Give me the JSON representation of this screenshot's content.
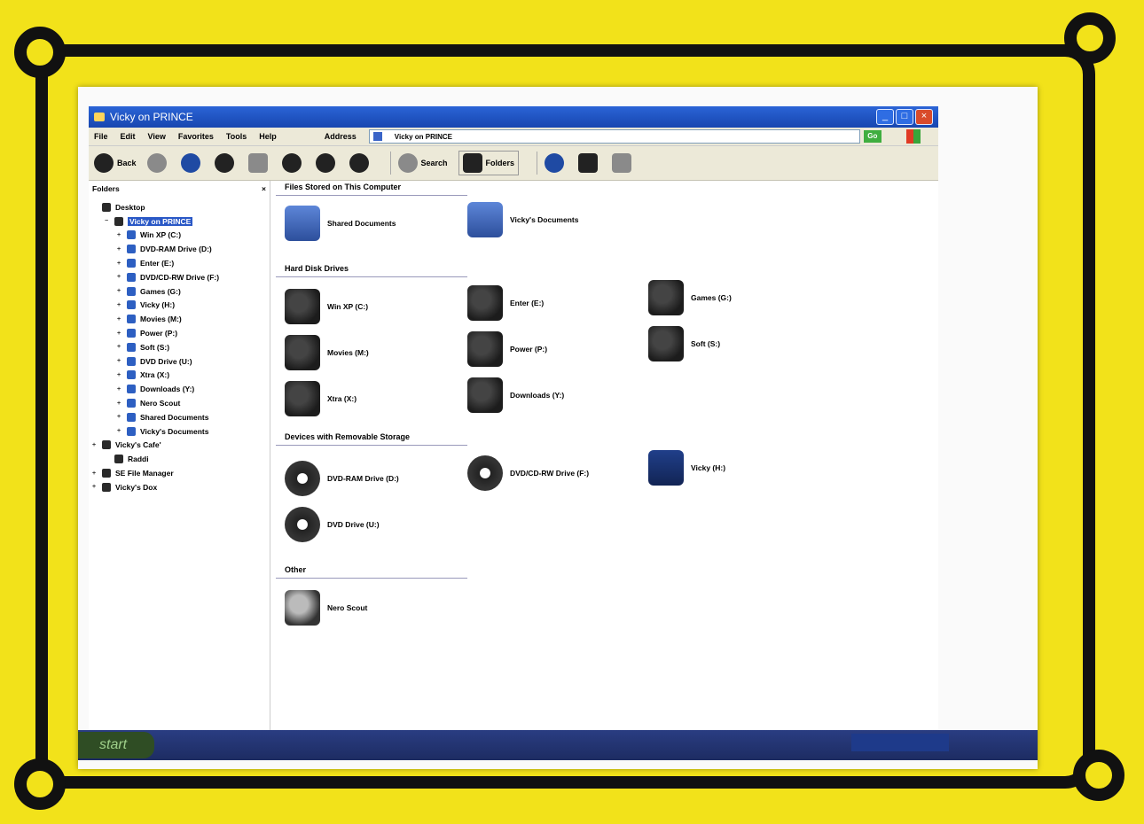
{
  "window": {
    "title": "Vicky on PRINCE",
    "controls": {
      "minimize": "_",
      "maximize": "□",
      "close": "×"
    }
  },
  "menu": {
    "items": [
      "File",
      "Edit",
      "View",
      "Favorites",
      "Tools",
      "Help"
    ],
    "address_label": "Address",
    "address_value": "Vicky on PRINCE",
    "go_label": "Go"
  },
  "toolbar": {
    "back_label": "Back",
    "search_label": "Search",
    "folders_label": "Folders"
  },
  "left_pane": {
    "header": "Folders",
    "close": "×",
    "tree": [
      {
        "label": "Desktop",
        "level": 0,
        "exp": ""
      },
      {
        "label": "Vicky on PRINCE",
        "level": 1,
        "exp": "−",
        "selected": true
      },
      {
        "label": "Win XP (C:)",
        "level": 2,
        "exp": "+"
      },
      {
        "label": "DVD-RAM Drive (D:)",
        "level": 2,
        "exp": "+"
      },
      {
        "label": "Enter (E:)",
        "level": 2,
        "exp": "+"
      },
      {
        "label": "DVD/CD-RW Drive (F:)",
        "level": 2,
        "exp": "+"
      },
      {
        "label": "Games (G:)",
        "level": 2,
        "exp": "+"
      },
      {
        "label": "Vicky (H:)",
        "level": 2,
        "exp": "+"
      },
      {
        "label": "Movies (M:)",
        "level": 2,
        "exp": "+"
      },
      {
        "label": "Power (P:)",
        "level": 2,
        "exp": "+"
      },
      {
        "label": "Soft (S:)",
        "level": 2,
        "exp": "+"
      },
      {
        "label": "DVD Drive (U:)",
        "level": 2,
        "exp": "+"
      },
      {
        "label": "Xtra (X:)",
        "level": 2,
        "exp": "+"
      },
      {
        "label": "Downloads (Y:)",
        "level": 2,
        "exp": "+"
      },
      {
        "label": "Nero Scout",
        "level": 2,
        "exp": "+"
      },
      {
        "label": "Shared Documents",
        "level": 2,
        "exp": "+"
      },
      {
        "label": "Vicky's Documents",
        "level": 2,
        "exp": "+"
      },
      {
        "label": "Vicky's Cafe'",
        "level": 0,
        "exp": "+"
      },
      {
        "label": "Raddi",
        "level": 1,
        "exp": ""
      },
      {
        "label": "SE File Manager",
        "level": 0,
        "exp": "+"
      },
      {
        "label": "Vicky's Dox",
        "level": 0,
        "exp": "+"
      }
    ]
  },
  "groups": {
    "files": "Files Stored on This Computer",
    "hard": "Hard Disk Drives",
    "removable": "Devices with Removable Storage",
    "other": "Other"
  },
  "items": {
    "shared_docs": "Shared Documents",
    "vicky_docs": "Vicky's Documents",
    "c": "Win XP (C:)",
    "e": "Enter (E:)",
    "g": "Games (G:)",
    "m": "Movies (M:)",
    "p": "Power (P:)",
    "s": "Soft (S:)",
    "x": "Xtra (X:)",
    "y": "Downloads (Y:)",
    "d": "DVD-RAM Drive (D:)",
    "f": "DVD/CD-RW Drive (F:)",
    "h": "Vicky (H:)",
    "u": "DVD Drive (U:)",
    "nero": "Nero Scout"
  },
  "taskbar": {
    "start_label": "start"
  }
}
